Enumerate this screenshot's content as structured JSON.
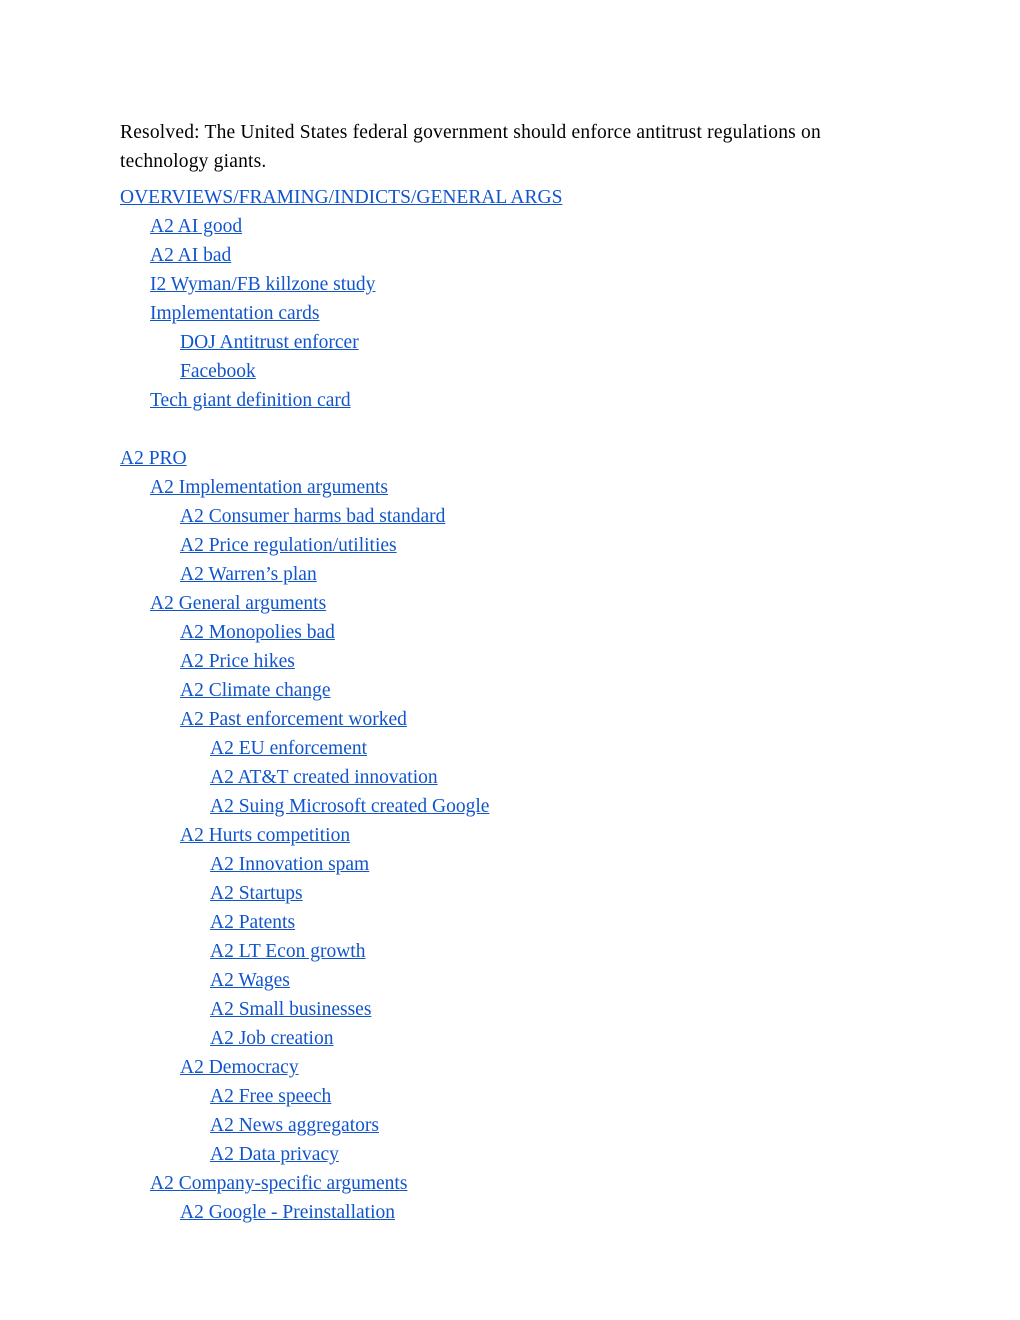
{
  "document": {
    "title": "Resolved: The United States federal government should enforce antitrust regulations on technology giants.",
    "link_color": "#1155cc",
    "text_color": "#000000",
    "background_color": "#ffffff"
  },
  "outline": [
    {
      "label": "OVERVIEWS/FRAMING/INDICTS/GENERAL ARGS",
      "level": 0,
      "type": "link"
    },
    {
      "label": "A2 AI good",
      "level": 1,
      "type": "link"
    },
    {
      "label": "A2 AI bad",
      "level": 1,
      "type": "link"
    },
    {
      "label": "I2 Wyman/FB killzone study",
      "level": 1,
      "type": "link"
    },
    {
      "label": "Implementation cards",
      "level": 1,
      "type": "link"
    },
    {
      "label": "DOJ Antitrust enforcer",
      "level": 2,
      "type": "link"
    },
    {
      "label": "Facebook",
      "level": 2,
      "type": "link"
    },
    {
      "label": "Tech giant definition card",
      "level": 1,
      "type": "link"
    },
    {
      "label": "",
      "level": 0,
      "type": "spacer"
    },
    {
      "label": "A2 PRO",
      "level": 0,
      "type": "link"
    },
    {
      "label": "A2 Implementation arguments",
      "level": 1,
      "type": "link"
    },
    {
      "label": "A2 Consumer harms bad standard",
      "level": 2,
      "type": "link"
    },
    {
      "label": "A2 Price regulation/utilities",
      "level": 2,
      "type": "link"
    },
    {
      "label": "A2 Warren’s plan",
      "level": 2,
      "type": "link"
    },
    {
      "label": "A2 General arguments",
      "level": 1,
      "type": "link"
    },
    {
      "label": "A2 Monopolies bad",
      "level": 2,
      "type": "link"
    },
    {
      "label": "A2 Price hikes",
      "level": 2,
      "type": "link"
    },
    {
      "label": "A2 Climate change",
      "level": 2,
      "type": "link"
    },
    {
      "label": "A2 Past enforcement worked",
      "level": 2,
      "type": "link"
    },
    {
      "label": "A2 EU enforcement",
      "level": 3,
      "type": "link"
    },
    {
      "label": "A2 AT&T created innovation",
      "level": 3,
      "type": "link"
    },
    {
      "label": "A2 Suing Microsoft created Google",
      "level": 3,
      "type": "link"
    },
    {
      "label": "A2 Hurts competition",
      "level": 2,
      "type": "link"
    },
    {
      "label": "A2 Innovation spam",
      "level": 3,
      "type": "link"
    },
    {
      "label": "A2 Startups",
      "level": 3,
      "type": "link"
    },
    {
      "label": "A2 Patents",
      "level": 3,
      "type": "link"
    },
    {
      "label": "A2 LT Econ growth",
      "level": 3,
      "type": "link"
    },
    {
      "label": "A2 Wages",
      "level": 3,
      "type": "link"
    },
    {
      "label": "A2 Small businesses",
      "level": 3,
      "type": "link"
    },
    {
      "label": "A2 Job creation",
      "level": 3,
      "type": "link"
    },
    {
      "label": "A2 Democracy",
      "level": 2,
      "type": "link"
    },
    {
      "label": "A2 Free speech",
      "level": 3,
      "type": "link"
    },
    {
      "label": "A2 News aggregators",
      "level": 3,
      "type": "link"
    },
    {
      "label": "A2 Data privacy",
      "level": 3,
      "type": "link"
    },
    {
      "label": "A2 Company-specific arguments",
      "level": 1,
      "type": "link"
    },
    {
      "label": "A2 Google - Preinstallation",
      "level": 2,
      "type": "link"
    }
  ]
}
